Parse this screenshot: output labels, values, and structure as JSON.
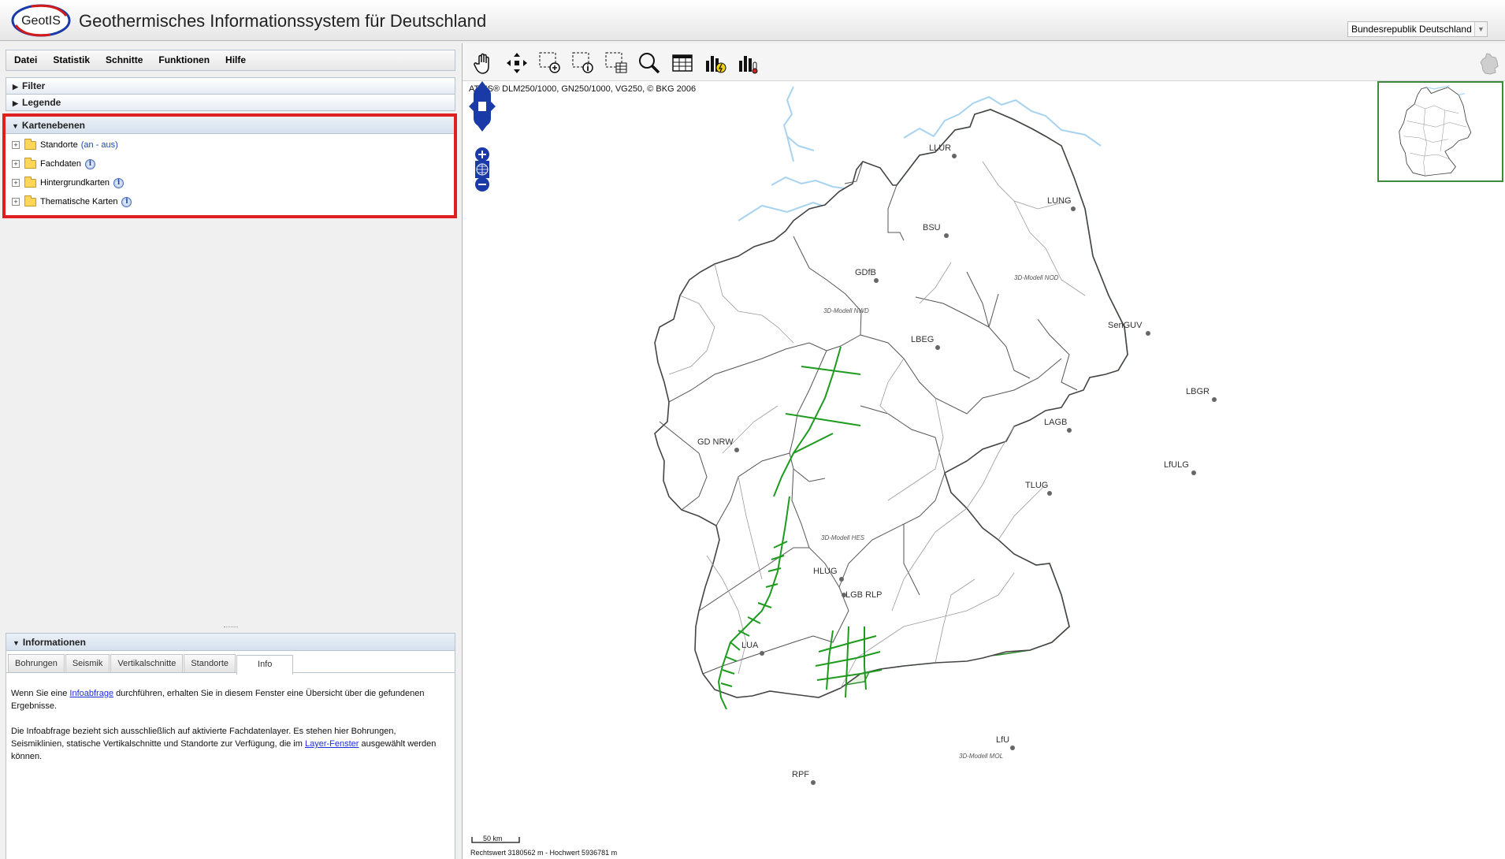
{
  "header": {
    "logo_text": "GeotIS",
    "title": "Geothermisches Informationssystem für Deutschland",
    "region_select": "Bundesrepublik Deutschland"
  },
  "menu": {
    "items": [
      {
        "label": "Datei"
      },
      {
        "label": "Statistik"
      },
      {
        "label": "Schnitte"
      },
      {
        "label": "Funktionen"
      },
      {
        "label": "Hilfe"
      }
    ]
  },
  "panels": {
    "filter": "Filter",
    "legende": "Legende",
    "kartenebenen": "Kartenebenen"
  },
  "layers": [
    {
      "label": "Standorte",
      "extra": "(an - aus)"
    },
    {
      "label": "Fachdaten"
    },
    {
      "label": "Hintergrundkarten"
    },
    {
      "label": "Thematische Karten"
    }
  ],
  "info": {
    "title": "Informationen",
    "tabs": [
      "Bohrungen",
      "Seismik",
      "Vertikalschnitte",
      "Standorte",
      "Info"
    ],
    "active_tab": "Info",
    "p1_a": "Wenn Sie eine ",
    "p1_link": "Infoabfrage",
    "p1_b": " durchführen, erhalten Sie in diesem Fenster eine Übersicht über die gefundenen Ergebnisse.",
    "p2_a": "Die Infoabfrage bezieht sich ausschließlich auf aktivierte Fachdatenlayer. Es stehen hier Bohrungen, Seismiklinien, statische Vertikalschnitte und Standorte zur Verfügung, die im ",
    "p2_link": "Layer-Fenster",
    "p2_b": " ausgewählt werden können."
  },
  "map": {
    "copyright": "ATKIS® DLM250/1000, GN250/1000, VG250, © BKG 2006",
    "scale": "50 km",
    "coords": "Rechtswert 3180562 m - Hochwert 5936781 m",
    "locations": [
      "LLUR",
      "LUNG",
      "BSU",
      "GDfB",
      "LBEG",
      "SenGUV",
      "LBGR",
      "LAGB",
      "GD NRW",
      "LfULG",
      "TLUG",
      "HLUG",
      "LGB RLP",
      "LUA",
      "LfU",
      "RPF"
    ],
    "model_labels": [
      "3D-Modell NOD",
      "3D-Modell NWD",
      "3D-Modell HES",
      "3D-Modell MOL"
    ]
  },
  "icons": [
    "pan-hand-icon",
    "full-extent-icon",
    "zoom-box-icon",
    "info-box-icon",
    "table-box-icon",
    "search-icon",
    "table-icon",
    "chart-power-icon",
    "chart-temperature-icon",
    "navigation-arrows-icon",
    "zoom-in-icon",
    "globe-icon",
    "zoom-out-icon",
    "germany-silhouette-icon"
  ],
  "colors": {
    "highlight_border": "#e02020",
    "model_fill": "#eef7ea",
    "model_line": "#2f8f2f",
    "nav_blue": "#1a3aa8"
  }
}
